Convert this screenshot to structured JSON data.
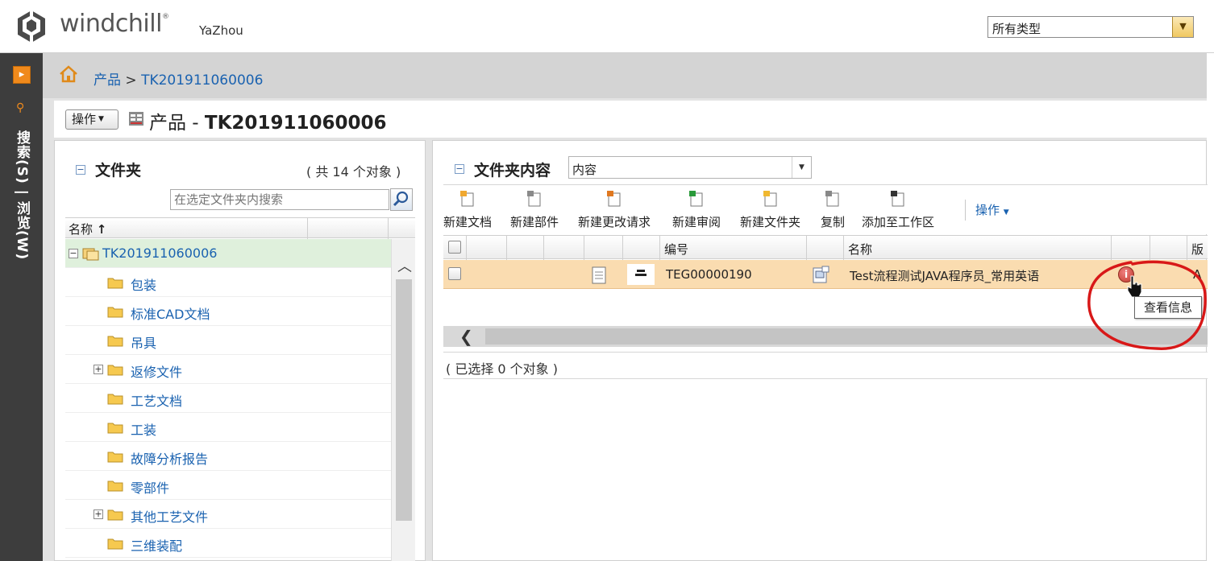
{
  "header": {
    "logo_text": "windchill",
    "logo_mark": "®",
    "user": "YaZhou",
    "type_filter": "所有类型"
  },
  "leftnav": {
    "vertical_label": "搜索(S) | 浏览(W)"
  },
  "breadcrumb": {
    "root": "产品",
    "separator": ">",
    "current": "TK201911060006"
  },
  "page": {
    "actions_label": "操作",
    "title_prefix": "产品 - ",
    "title_product": "TK201911060006"
  },
  "folders_panel": {
    "title": "文件夹",
    "count": "( 共 14 个对象 )",
    "search_placeholder": "在选定文件夹内搜索",
    "column_name": "名称",
    "sort_indicator": "↑",
    "root_node": "TK201911060006",
    "items": [
      {
        "label": "包装",
        "expandable": false
      },
      {
        "label": "标准CAD文档",
        "expandable": false
      },
      {
        "label": "吊具",
        "expandable": false
      },
      {
        "label": "返修文件",
        "expandable": true
      },
      {
        "label": "工艺文档",
        "expandable": false
      },
      {
        "label": "工装",
        "expandable": false
      },
      {
        "label": "故障分析报告",
        "expandable": false
      },
      {
        "label": "零部件",
        "expandable": false
      },
      {
        "label": "其他工艺文件",
        "expandable": true
      },
      {
        "label": "三维装配",
        "expandable": false
      }
    ]
  },
  "contents_panel": {
    "title": "文件夹内容",
    "view_select": "内容",
    "toolbar": [
      {
        "label": "新建文档",
        "icon": "new-document-icon"
      },
      {
        "label": "新建部件",
        "icon": "new-part-icon"
      },
      {
        "label": "新建更改请求",
        "icon": "new-change-request-icon"
      },
      {
        "label": "新建审阅",
        "icon": "new-review-icon"
      },
      {
        "label": "新建文件夹",
        "icon": "new-folder-icon"
      },
      {
        "label": "复制",
        "icon": "copy-icon"
      },
      {
        "label": "添加至工作区",
        "icon": "add-to-workspace-icon"
      }
    ],
    "toolbar_actions": "操作",
    "columns": {
      "number": "编号",
      "name": "名称",
      "version": "版本"
    },
    "row": {
      "number": "TEG00000190",
      "name": "Test流程测试JAVA程序员_常用英语",
      "version_partial": "A"
    },
    "tooltip": "查看信息",
    "selection_status": "( 已选择 0 个对象 )"
  }
}
